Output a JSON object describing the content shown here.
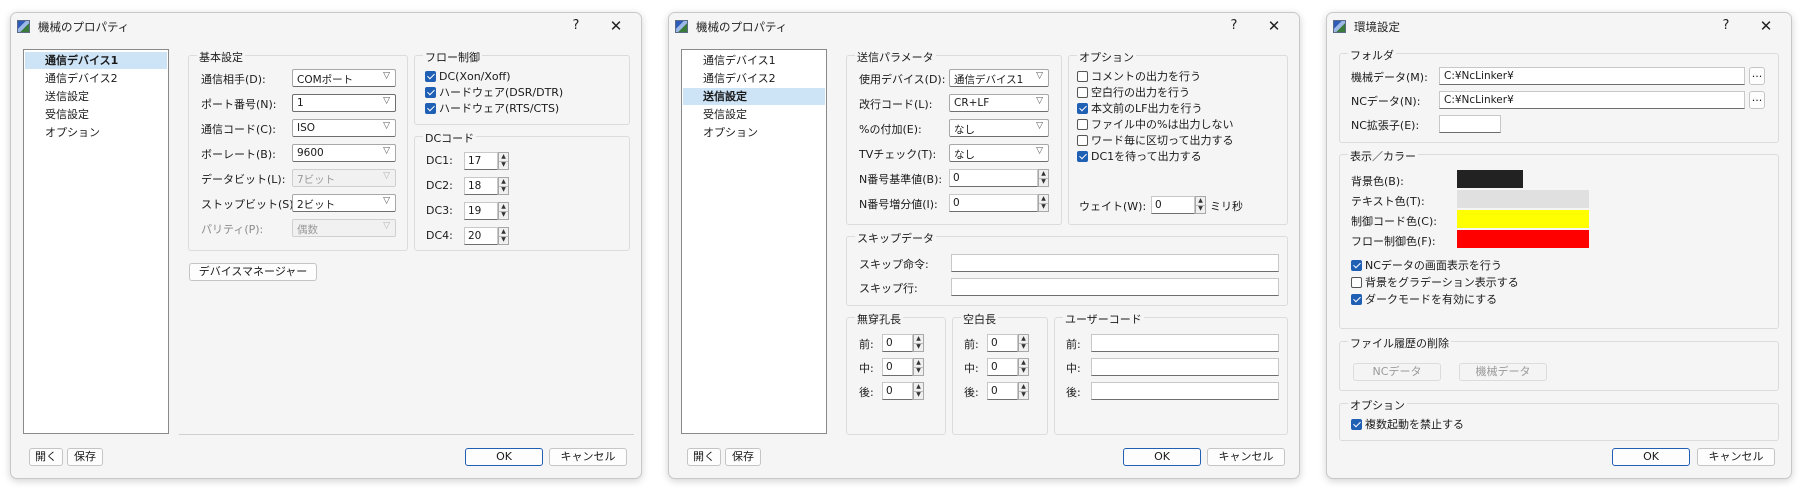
{
  "windows": {
    "w1": {
      "title": "機械のプロパティ",
      "nav": [
        "通信デバイス1",
        "通信デバイス2",
        "送信設定",
        "受信設定",
        "オプション"
      ],
      "basic": {
        "title": "基本設定",
        "rows": [
          {
            "label": "通信相手(D):",
            "value": "COMポート"
          },
          {
            "label": "ポート番号(N):",
            "value": "1"
          },
          {
            "label": "通信コード(C):",
            "value": "ISO"
          },
          {
            "label": "ボーレート(B):",
            "value": "9600"
          },
          {
            "label": "データビット(L):",
            "value": "7ビット"
          },
          {
            "label": "ストップビット(S):",
            "value": "2ビット"
          },
          {
            "label": "パリティ(P):",
            "value": "偶数"
          }
        ]
      },
      "flow": {
        "title": "フロー制御",
        "items": [
          "DC(Xon/Xoff)",
          "ハードウェア(DSR/DTR)",
          "ハードウェア(RTS/CTS)"
        ]
      },
      "dc": {
        "title": "DCコード",
        "rows": [
          {
            "label": "DC1:",
            "value": "17"
          },
          {
            "label": "DC2:",
            "value": "18"
          },
          {
            "label": "DC3:",
            "value": "19"
          },
          {
            "label": "DC4:",
            "value": "20"
          }
        ]
      },
      "device_manager": "デバイスマネージャー",
      "open": "開く",
      "save": "保存",
      "ok": "OK",
      "cancel": "キャンセル"
    },
    "w2": {
      "title": "機械のプロパティ",
      "nav": [
        "通信デバイス1",
        "通信デバイス2",
        "送信設定",
        "受信設定",
        "オプション"
      ],
      "send": {
        "title": "送信パラメータ",
        "rows": [
          {
            "label": "使用デバイス(D):",
            "value": "通信デバイス1"
          },
          {
            "label": "改行コード(L):",
            "value": "CR+LF"
          },
          {
            "label": "%の付加(E):",
            "value": "なし"
          },
          {
            "label": "TVチェック(T):",
            "value": "なし"
          }
        ],
        "spins": [
          {
            "label": "N番号基準値(B):",
            "value": "0"
          },
          {
            "label": "N番号増分値(I):",
            "value": "0"
          }
        ]
      },
      "option": {
        "title": "オプション",
        "items": [
          {
            "label": "コメントの出力を行う",
            "checked": false
          },
          {
            "label": "空白行の出力を行う",
            "checked": false
          },
          {
            "label": "本文前のLF出力を行う",
            "checked": true
          },
          {
            "label": "ファイル中の%は出力しない",
            "checked": false
          },
          {
            "label": "ワード毎に区切って出力する",
            "checked": false
          },
          {
            "label": "DC1を待って出力する",
            "checked": true
          }
        ],
        "wait_label": "ウェイト(W):",
        "wait_value": "0",
        "wait_unit": "ミリ秒"
      },
      "skip": {
        "title": "スキップデータ",
        "cmd_label": "スキップ命令:",
        "row_label": "スキップ行:"
      },
      "mukou": {
        "title": "無穿孔長",
        "rows": [
          {
            "label": "前:",
            "value": "0"
          },
          {
            "label": "中:",
            "value": "0"
          },
          {
            "label": "後:",
            "value": "0"
          }
        ]
      },
      "kuhaku": {
        "title": "空白長",
        "rows": [
          {
            "label": "前:",
            "value": "0"
          },
          {
            "label": "中:",
            "value": "0"
          },
          {
            "label": "後:",
            "value": "0"
          }
        ]
      },
      "user": {
        "title": "ユーザーコード",
        "rows": [
          {
            "label": "前:"
          },
          {
            "label": "中:"
          },
          {
            "label": "後:"
          }
        ]
      },
      "open": "開く",
      "save": "保存",
      "ok": "OK",
      "cancel": "キャンセル"
    },
    "w3": {
      "title": "環境設定",
      "folder": {
        "title": "フォルダ",
        "machine_label": "機械データ(M):",
        "machine_value": "C:¥NcLinker¥",
        "nc_label": "NCデータ(N):",
        "nc_value": "C:¥NcLinker¥",
        "ext_label": "NC拡張子(E):",
        "browse": "..."
      },
      "display": {
        "title": "表示／カラー",
        "colors": [
          {
            "label": "背景色(B):",
            "color": "#222222"
          },
          {
            "label": "テキスト色(T):",
            "color": "#e0e0e0"
          },
          {
            "label": "制御コード色(C):",
            "color": "#ffff00"
          },
          {
            "label": "フロー制御色(F):",
            "color": "#ff0000"
          }
        ],
        "checks": [
          {
            "label": "NCデータの画面表示を行う",
            "checked": true
          },
          {
            "label": "背景をグラデーション表示する",
            "checked": false
          },
          {
            "label": "ダークモードを有効にする",
            "checked": true
          }
        ]
      },
      "history": {
        "title": "ファイル履歴の削除",
        "nc": "NCデータ",
        "machine": "機械データ"
      },
      "option": {
        "title": "オプション",
        "multi": "複数起動を禁止する"
      },
      "ok": "OK",
      "cancel": "キャンセル"
    }
  }
}
